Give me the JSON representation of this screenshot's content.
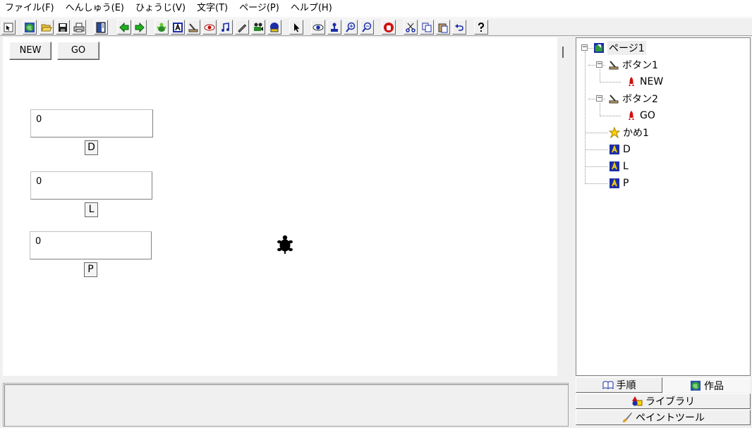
{
  "menu": [
    "ファイル(F)",
    "へんしゅう(E)",
    "ひょうじ(V)",
    "文字(T)",
    "ページ(P)",
    "ヘルプ(H)"
  ],
  "stage": {
    "buttons": [
      {
        "label": "NEW"
      },
      {
        "label": "GO"
      }
    ],
    "fields": [
      {
        "value": "0",
        "label": "D"
      },
      {
        "value": "0",
        "label": "L"
      },
      {
        "value": "0",
        "label": "P"
      }
    ]
  },
  "tree": {
    "root": "ページ1",
    "button1": "ボタン1",
    "button1_child": "NEW",
    "button2": "ボタン2",
    "button2_child": "GO",
    "turtle": "かめ1",
    "text_d": "D",
    "text_l": "L",
    "text_p": "P"
  },
  "tabs": {
    "steps": "手順",
    "works": "作品",
    "library": "ライブラリ",
    "paint": "ペイントツール"
  },
  "colors": {
    "text_icon_blue": "#1b2ea8",
    "text_icon_yellow": "#ffd200",
    "rocket_red": "#d01010"
  }
}
